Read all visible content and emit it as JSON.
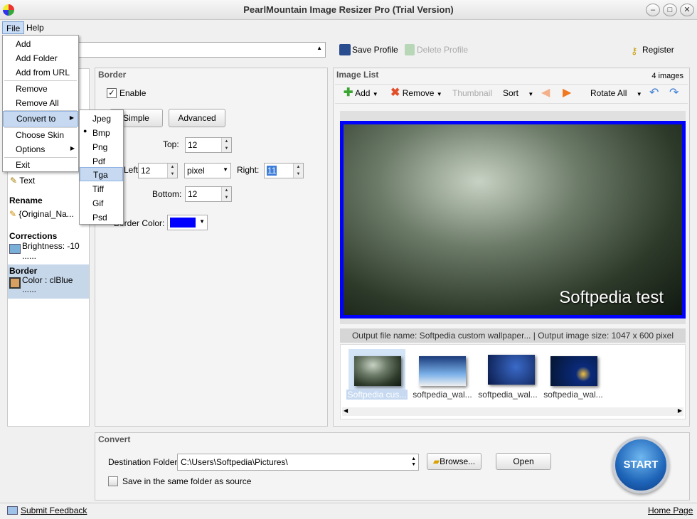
{
  "window": {
    "title": "PearlMountain Image Resizer Pro (Trial Version)",
    "minimize": "–",
    "maximize": "□",
    "close": "✕"
  },
  "menubar": {
    "file": "File",
    "help": "Help"
  },
  "file_menu": {
    "items": [
      "Add",
      "Add Folder",
      "Add from URL",
      "Remove",
      "Remove All",
      "Convert to",
      "Choose Skin",
      "Options",
      "Exit"
    ],
    "submenu_arrow": "▶"
  },
  "convert_submenu": {
    "items": [
      "Jpeg",
      "Bmp",
      "Png",
      "Pdf",
      "Tga",
      "Tiff",
      "Gif",
      "Psd"
    ],
    "checked": "Bmp",
    "highlighted": "Tga"
  },
  "profile_bar": {
    "save_profile": "Save Profile",
    "delete_profile": "Delete Profile",
    "register": "Register"
  },
  "left_panel": {
    "watermark_label": "Text",
    "rename": {
      "title": "Rename",
      "value": "{Original_Na..."
    },
    "corrections": {
      "title": "Corrections",
      "line1": "Brightness: -10",
      "line2": "......"
    },
    "border": {
      "title": "Border",
      "line1": "Color : clBlue",
      "line2": "......"
    }
  },
  "border_panel": {
    "title": "Border",
    "enable": "Enable",
    "tab_simple": "Simple",
    "tab_advanced": "Advanced",
    "top_label": "Top:",
    "top_value": "12",
    "left_label": "Left:",
    "left_value": "12",
    "unit": "pixel",
    "right_label": "Right:",
    "right_value": "11",
    "bottom_label": "Bottom:",
    "bottom_value": "12",
    "color_label": "Border Color:",
    "color_value": "#0000ff"
  },
  "image_list": {
    "title": "Image List",
    "count": "4 images",
    "toolbar": {
      "add": "Add",
      "remove": "Remove",
      "thumbnail": "Thumbnail",
      "sort": "Sort",
      "rotate_all": "Rotate All"
    },
    "preview_text": "Softpedia test",
    "output_info": "Output file name: Softpedia custom wallpaper... | Output image size: 1047 x 600 pixel",
    "thumbnails": [
      "Softpedia cus...",
      "softpedia_wal...",
      "softpedia_wal...",
      "softpedia_wal..."
    ]
  },
  "convert_panel": {
    "title": "Convert",
    "dest_label": "Destination Folder:",
    "dest_value": "C:\\Users\\Softpedia\\Pictures\\",
    "browse": "Browse...",
    "open": "Open",
    "same_folder": "Save in the same folder as source",
    "start": "START"
  },
  "statusbar": {
    "feedback": "Submit Feedback",
    "home": "Home Page"
  },
  "colors": {
    "accent": "#2f78c4",
    "border_blue": "#0000ff"
  }
}
